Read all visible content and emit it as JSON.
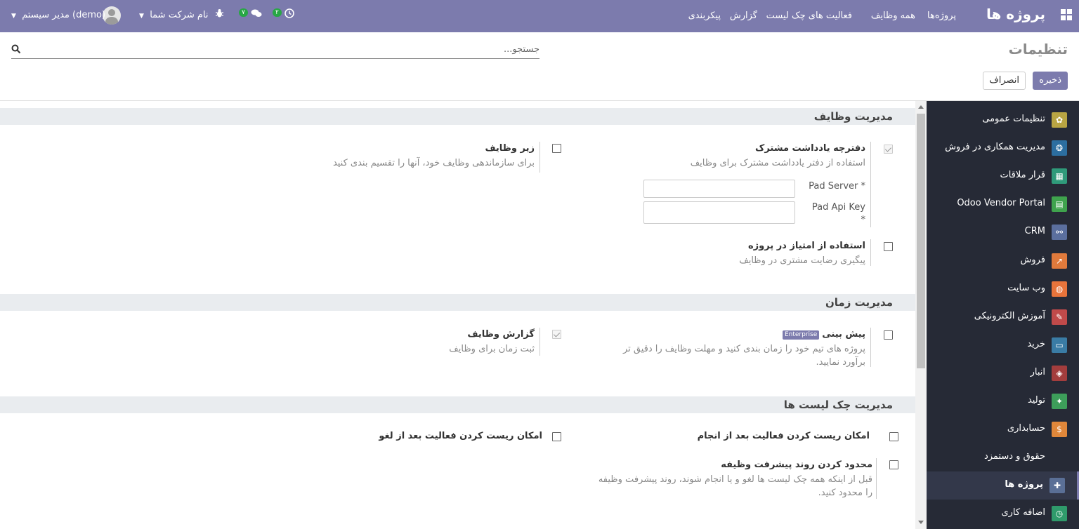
{
  "navbar": {
    "brand": "پروژه ها",
    "menus": [
      "پروژه‌ها",
      "همه وظایف",
      "فعالیت های چک لیست",
      "گزارش",
      "پیکربندی"
    ],
    "activity_count": "۲",
    "message_count": "۷",
    "company_label": "نام شرکت شما",
    "user_label": "مدیر سیستم (demo)"
  },
  "control_panel": {
    "title": "تنظیمات",
    "search_placeholder": "جستجو...",
    "save_label": "ذخیره",
    "cancel_label": "انصراف"
  },
  "sidebar": {
    "items": [
      {
        "label": "تنظیمات عمومی",
        "icon": "gear-icon",
        "color": "#b9a543",
        "glyph": "✿"
      },
      {
        "label": "مدیریت همکاری در فروش",
        "icon": "share-icon",
        "color": "#2c6ea0",
        "glyph": "❂"
      },
      {
        "label": "قرار ملاقات",
        "icon": "calendar-icon",
        "color": "#2f9a7a",
        "glyph": "▦"
      },
      {
        "label": "Odoo Vendor Portal",
        "icon": "portal-icon",
        "color": "#3fa34d",
        "glyph": "▤"
      },
      {
        "label": "CRM",
        "icon": "handshake-icon",
        "color": "#5b6f9e",
        "glyph": "⚯"
      },
      {
        "label": "فروش",
        "icon": "chart-icon",
        "color": "#e07a3c",
        "glyph": "↗"
      },
      {
        "label": "وب سایت",
        "icon": "globe-icon",
        "color": "#e8743b",
        "glyph": "◍"
      },
      {
        "label": "آموزش الکترونیکی",
        "icon": "elearning-icon",
        "color": "#c04a4a",
        "glyph": "✎"
      },
      {
        "label": "خرید",
        "icon": "card-icon",
        "color": "#3a7ca5",
        "glyph": "▭"
      },
      {
        "label": "انبار",
        "icon": "box-icon",
        "color": "#a33d3d",
        "glyph": "◈"
      },
      {
        "label": "تولید",
        "icon": "wrench-icon",
        "color": "#3d9e5a",
        "glyph": "✦"
      },
      {
        "label": "حسابداری",
        "icon": "invoice-icon",
        "color": "#e0873a",
        "glyph": "$"
      },
      {
        "label": "حقوق و دستمزد",
        "icon": "",
        "color": "",
        "glyph": ""
      },
      {
        "label": "پروژه ها",
        "icon": "puzzle-icon",
        "color": "#5a6f96",
        "glyph": "✚"
      },
      {
        "label": "اضافه کاری",
        "icon": "clock-calendar-icon",
        "color": "#2f9a6b",
        "glyph": "◷"
      }
    ]
  },
  "sections": {
    "tasks": {
      "title": "مدیریت وظایف",
      "collab_pad": {
        "title": "دفترچه یادداشت مشترک",
        "desc": "استفاده از دفتر یادداشت مشترک برای وظایف",
        "pad_server_label": "Pad Server *",
        "pad_api_key_label": "Pad Api Key",
        "pad_api_key_star": "*"
      },
      "subtasks": {
        "title": "زیر وظایف",
        "desc": "برای سازماندهی وظایف خود، آنها را تقسیم بندی کنید"
      },
      "rating": {
        "title": "استفاده از امتیاز در پروژه",
        "desc": "پیگیری رضایت مشتری در وظایف"
      }
    },
    "time": {
      "title": "مدیریت زمان",
      "forecast": {
        "title": "پیش بینی",
        "badge": "Enterprise",
        "desc": "پروژه های تیم خود را زمان بندی کنید و مهلت وظایف را دقیق تر برآورد نمایید."
      },
      "timesheets": {
        "title": "گزارش وظایف",
        "desc": "ثبت زمان برای وظایف"
      }
    },
    "checklist": {
      "title": "مدیریت چک لیست ها",
      "reset_done": {
        "title": "امکان ریست کردن فعالیت بعد از انجام"
      },
      "reset_cancel": {
        "title": "امکان ریست کردن فعالیت بعد از لغو"
      },
      "restrict": {
        "title": "محدود کردن روند پیشرفت وظیفه",
        "desc": "قبل از اینکه همه چک لیست ها لغو و یا انجام شوند، روند پیشرفت وظیفه را محدود کنید."
      }
    }
  }
}
